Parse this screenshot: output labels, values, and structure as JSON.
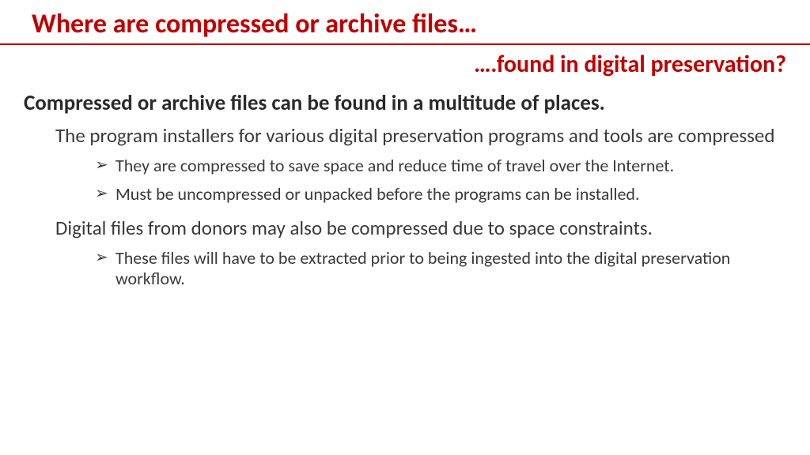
{
  "title": "Where are compressed or archive files…",
  "subtitle": "….found in digital preservation?",
  "lead": "Compressed or archive files can be found in a multitude of places.",
  "sections": [
    {
      "para": "The program installers for various digital preservation programs and tools are compressed",
      "bullets": [
        "They are compressed to save space and reduce time of travel over the Internet.",
        "Must be uncompressed or unpacked before the programs can be installed."
      ]
    },
    {
      "para": "Digital files from donors may also be compressed due to space constraints.",
      "bullets": [
        "These files will have to be extracted prior to being ingested into the digital preservation workflow."
      ]
    }
  ],
  "arrow_glyph": "➢"
}
